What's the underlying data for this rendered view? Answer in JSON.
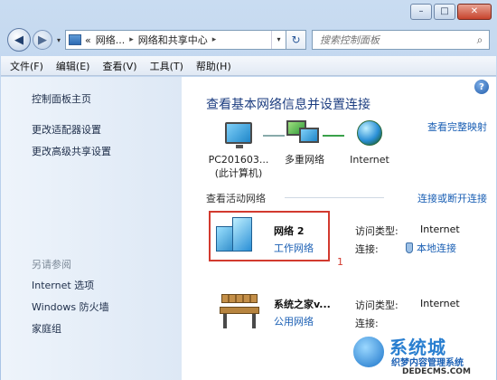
{
  "window": {
    "controls": {
      "minimize": "–",
      "maximize": "□",
      "close": "✕"
    }
  },
  "nav": {
    "back_icon": "back-arrow-icon",
    "forward_icon": "forward-arrow-icon",
    "address": {
      "segments": [
        "«",
        "网络...",
        "网络和共享中心"
      ],
      "separators": [
        "▸",
        "▸"
      ]
    },
    "search_placeholder": "搜索控制面板"
  },
  "menubar": {
    "items": [
      "文件(F)",
      "编辑(E)",
      "查看(V)",
      "工具(T)",
      "帮助(H)"
    ]
  },
  "sidebar": {
    "links": [
      "控制面板主页",
      "更改适配器设置",
      "更改高级共享设置"
    ],
    "see_also_heading": "另请参阅",
    "see_also_links": [
      "Internet 选项",
      "Windows 防火墙",
      "家庭组"
    ]
  },
  "main": {
    "title": "查看基本网络信息并设置连接",
    "view_full_map": "查看完整映射",
    "map": {
      "computer": "PC201603...",
      "computer_sub": "(此计算机)",
      "network": "多重网络",
      "internet": "Internet"
    },
    "active_label": "查看活动网络",
    "connect_link": "连接或断开连接",
    "networks": [
      {
        "name": "网络  2",
        "type": "工作网络",
        "access_key": "访问类型:",
        "access_value": "Internet",
        "conn_key": "连接:",
        "conn_value": "本地连接",
        "marker": "1"
      },
      {
        "name": "系统之家v...",
        "type": "公用网络",
        "access_key": "访问类型:",
        "access_value": "Internet",
        "conn_key": "连接:"
      }
    ]
  },
  "watermark": {
    "top": "系统城",
    "mid": "织梦内容管理系统",
    "bot": "DEDECMS.COM"
  }
}
